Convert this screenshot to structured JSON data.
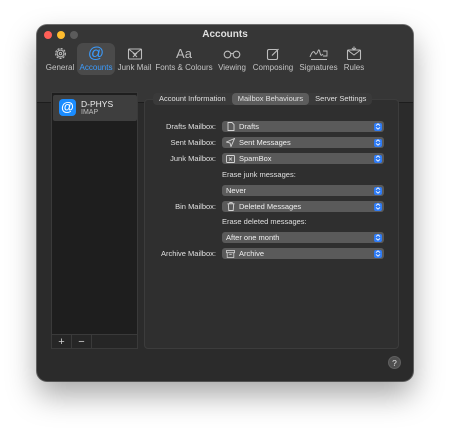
{
  "window": {
    "title": "Accounts"
  },
  "toolbar": {
    "items": [
      {
        "label": "General",
        "icon": "gear-icon"
      },
      {
        "label": "Accounts",
        "icon": "at-icon",
        "active": true
      },
      {
        "label": "Junk Mail",
        "icon": "junk-mail-icon"
      },
      {
        "label": "Fonts & Colours",
        "icon": "fonts-icon"
      },
      {
        "label": "Viewing",
        "icon": "glasses-icon"
      },
      {
        "label": "Composing",
        "icon": "compose-icon"
      },
      {
        "label": "Signatures",
        "icon": "signature-icon"
      },
      {
        "label": "Rules",
        "icon": "rules-icon"
      }
    ]
  },
  "sidebar": {
    "accounts": [
      {
        "name": "D-PHYS",
        "type": "IMAP",
        "icon": "@"
      }
    ],
    "add_label": "+",
    "remove_label": "−"
  },
  "tabs": [
    {
      "label": "Account Information"
    },
    {
      "label": "Mailbox Behaviours",
      "active": true
    },
    {
      "label": "Server Settings"
    }
  ],
  "form": {
    "drafts": {
      "label": "Drafts Mailbox:",
      "value": "Drafts",
      "icon": "document-icon"
    },
    "sent": {
      "label": "Sent Mailbox:",
      "value": "Sent Messages",
      "icon": "paper-plane-icon"
    },
    "junk": {
      "label": "Junk Mailbox:",
      "value": "SpamBox",
      "icon": "junk-tray-icon"
    },
    "erase_junk": {
      "label": "Erase junk messages:",
      "value": "Never"
    },
    "bin": {
      "label": "Bin Mailbox:",
      "value": "Deleted Messages",
      "icon": "trash-icon"
    },
    "erase_deleted": {
      "label": "Erase deleted messages:",
      "value": "After one month"
    },
    "archive": {
      "label": "Archive Mailbox:",
      "value": "Archive",
      "icon": "archive-box-icon"
    }
  },
  "help": {
    "label": "?"
  },
  "colors": {
    "accent": "#3b9cff",
    "popup_chevron": "#2f7cf6",
    "window_bg": "#2b2b2b"
  }
}
